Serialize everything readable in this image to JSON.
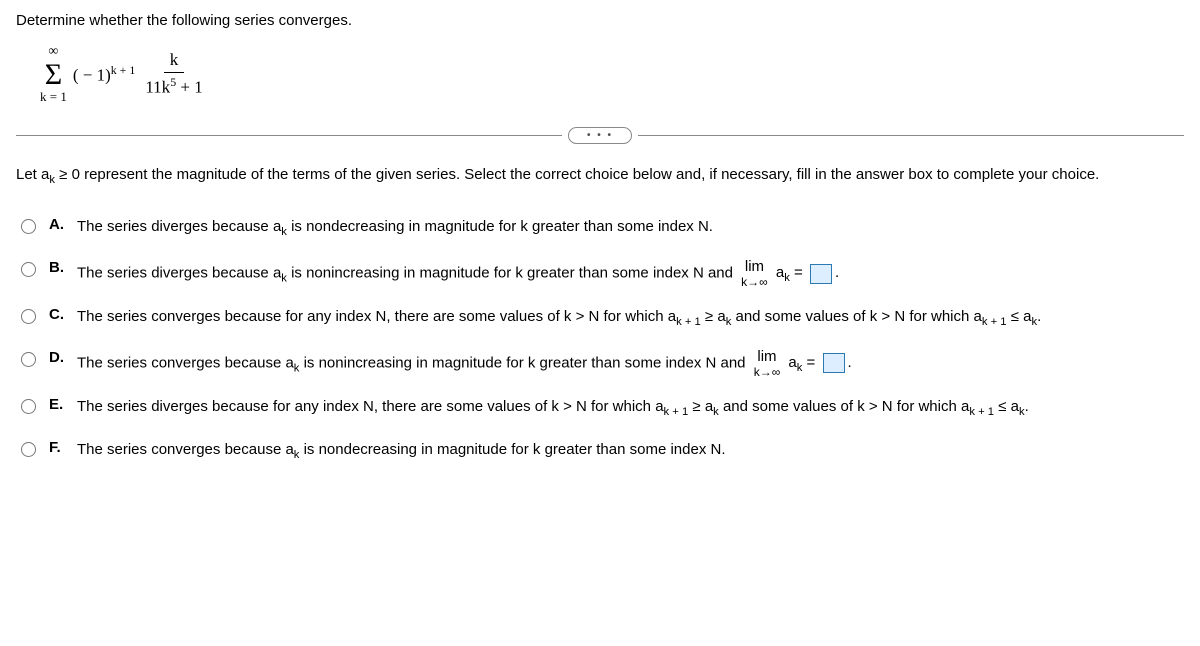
{
  "prompt": "Determine whether the following series converges.",
  "series": {
    "sigma_top": "∞",
    "sigma_bottom": "k = 1",
    "coeff_prefix": "( − 1)",
    "coeff_exp": "k + 1",
    "frac_num": "k",
    "frac_den_pre": "11k",
    "frac_den_exp": "5",
    "frac_den_post": " + 1"
  },
  "ellipsis": "• • •",
  "instruction_pre": "Let a",
  "instruction_sub": "k",
  "instruction_post": " ≥ 0 represent the magnitude of the terms of the given series. Select the correct choice below and, if necessary, fill in the answer box to complete your choice.",
  "lim": {
    "top": "lim",
    "bottom": "k→∞"
  },
  "ak": {
    "base": "a",
    "sub": "k"
  },
  "ak1": {
    "base": "a",
    "sub": "k + 1"
  },
  "choices": {
    "A": {
      "label": "A.",
      "t1": "The series diverges because a",
      "t2": " is nondecreasing in magnitude for k greater than some index N."
    },
    "B": {
      "label": "B.",
      "t1": "The series diverges because a",
      "t2": " is nonincreasing in magnitude for k greater than some index N and ",
      "eq": " =",
      "period": "."
    },
    "C": {
      "label": "C.",
      "t1": "The series converges because for any index N, there are some values of k > N for which a",
      "t2": " ≥ a",
      "t3": " and some values of k > N for which a",
      "t4": " ≤ a",
      "t5": "."
    },
    "D": {
      "label": "D.",
      "t1": "The series converges because a",
      "t2": " is nonincreasing in magnitude for k greater than some index N and ",
      "eq": " =",
      "period": "."
    },
    "E": {
      "label": "E.",
      "t1": "The series diverges because for any index N, there are some values of k > N for which a",
      "t2": " ≥ a",
      "t3": " and some values of k > N for which a",
      "t4": " ≤ a",
      "t5": "."
    },
    "F": {
      "label": "F.",
      "t1": "The series converges because a",
      "t2": " is nondecreasing in magnitude for k greater than some index N."
    }
  }
}
